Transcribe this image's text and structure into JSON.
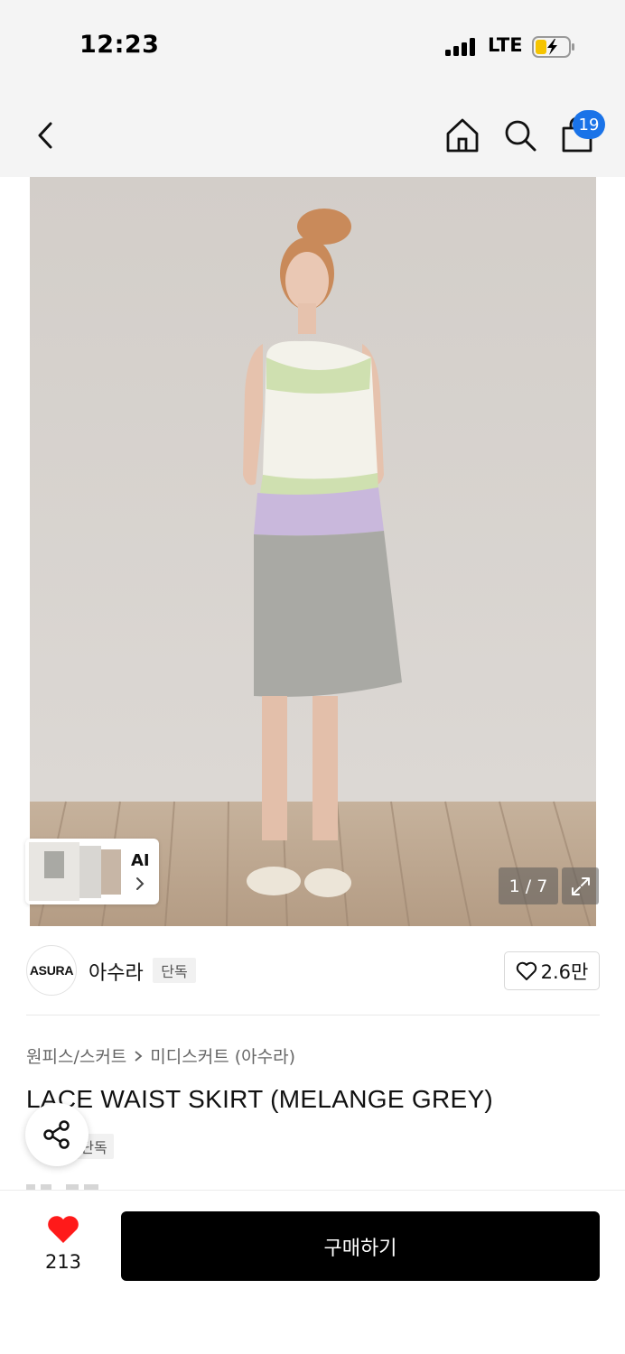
{
  "status_bar": {
    "time": "12:23",
    "network": "LTE",
    "icons": [
      "signal-icon",
      "battery-charging-icon"
    ]
  },
  "nav": {
    "back_icon": "back-chevron-icon",
    "home_icon": "home-icon",
    "search_icon": "search-icon",
    "cart_icon": "shopping-bag-icon",
    "cart_count": "19",
    "badge_color": "#1a73e8"
  },
  "gallery": {
    "counter": "1 / 7",
    "ai_label": "AI",
    "expand_icon": "expand-icon"
  },
  "brand": {
    "logo_text": "ASURA",
    "name": "아수라",
    "exclusive_badge": "단독",
    "like_count": "2.6만"
  },
  "product": {
    "breadcrumb": [
      "원피스/스커트",
      "미디스커트 (아수라)"
    ],
    "title": "LACE WAIST SKIRT (MELANGE GREY)",
    "exclusive_badge": "단독",
    "share_icon": "share-icon"
  },
  "bottom_bar": {
    "favorite_count": "213",
    "favorite_icon": "heart-icon",
    "favorite_color": "#ff1a1a",
    "buy_label": "구매하기"
  }
}
